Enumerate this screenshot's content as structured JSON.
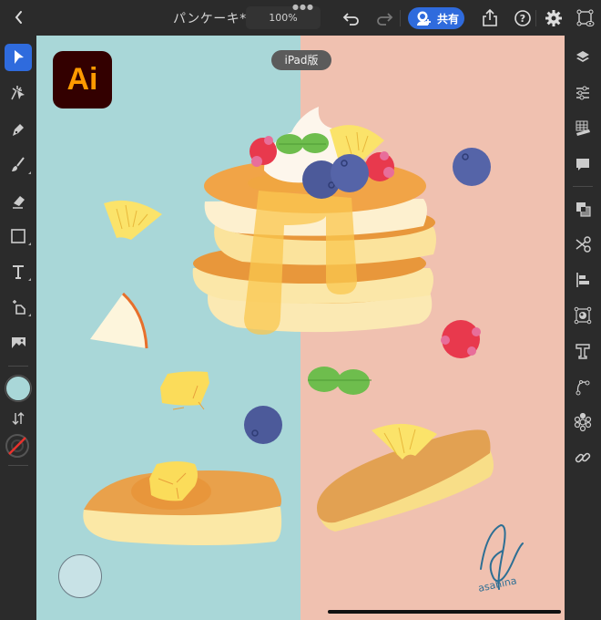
{
  "app": {
    "document_title": "パンケーキ*",
    "zoom_level": "100%",
    "share_label": "共有",
    "version_badge": "iPad版",
    "logo_text": "Ai",
    "accent_color": "#2f6bdd"
  },
  "topbar": {
    "icons": [
      "back-icon",
      "more-dots-icon",
      "undo-icon",
      "redo-icon",
      "share-user-icon",
      "export-icon",
      "help-icon",
      "settings-icon",
      "selection-view-icon"
    ]
  },
  "left_toolbar": {
    "tools": [
      {
        "name": "selection-tool",
        "active": true
      },
      {
        "name": "direct-selection-tool",
        "active": false
      },
      {
        "name": "pen-tool",
        "active": false
      },
      {
        "name": "brush-tool",
        "active": false
      },
      {
        "name": "eraser-tool",
        "active": false
      },
      {
        "name": "rectangle-tool",
        "active": false
      },
      {
        "name": "type-tool",
        "active": false
      },
      {
        "name": "transform-tool",
        "active": false
      },
      {
        "name": "place-image-tool",
        "active": false
      }
    ],
    "fill_color": "#a9d7d8",
    "stroke_color": "none"
  },
  "right_toolbar": {
    "panels": [
      "layers-icon",
      "properties-icon",
      "grid-ruler-icon",
      "comments-icon",
      "combine-shapes-icon",
      "cut-icon",
      "align-icon",
      "vectorize-icon",
      "type-panel-icon",
      "path-icon",
      "repeat-icon",
      "link-icon"
    ]
  },
  "canvas": {
    "left_bg_color": "#a9d7d8",
    "right_bg_color": "#f0c1b0",
    "signature": "asahina"
  }
}
